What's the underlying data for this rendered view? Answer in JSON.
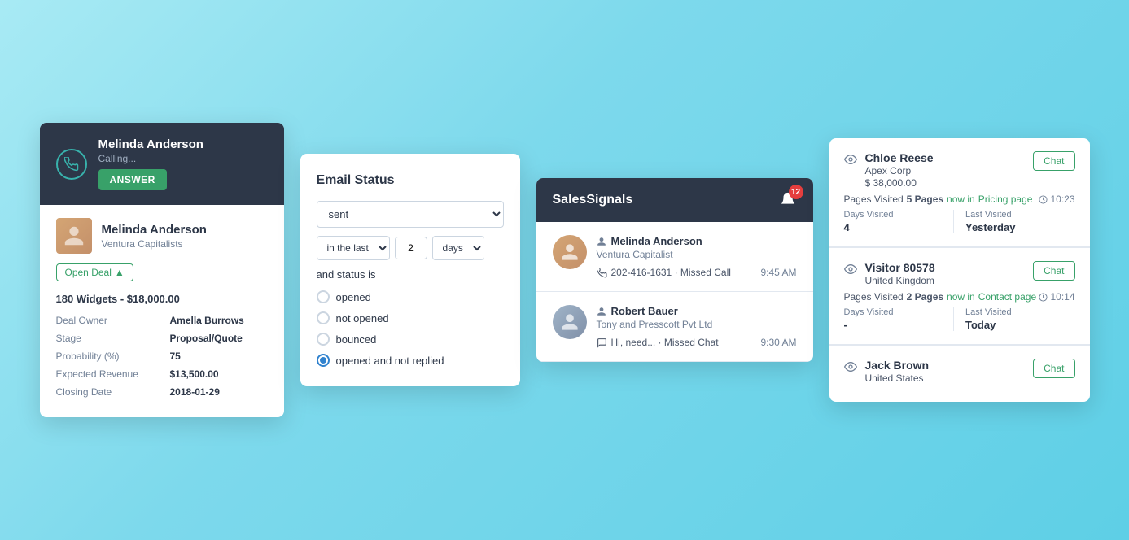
{
  "background": {
    "color_start": "#a8eaf4",
    "color_end": "#5ecfe6"
  },
  "calling_card": {
    "header": {
      "name": "Melinda Anderson",
      "status": "Calling...",
      "answer_label": "ANSWER"
    },
    "contact": {
      "name": "Melinda Anderson",
      "company": "Ventura Capitalists"
    },
    "open_deal_label": "Open Deal",
    "deal_title": "180 Widgets - $18,000.00",
    "deal_fields": [
      {
        "label": "Deal Owner",
        "value": "Amella Burrows"
      },
      {
        "label": "Stage",
        "value": "Proposal/Quote"
      },
      {
        "label": "Probability (%)",
        "value": "75"
      },
      {
        "label": "Expected Revenue",
        "value": "$13,500.00"
      },
      {
        "label": "Closing Date",
        "value": "2018-01-29"
      }
    ]
  },
  "email_panel": {
    "title": "Email Status",
    "sent_option": "sent",
    "in_the_last_label": "in the last",
    "days_value": "2",
    "days_unit": "days",
    "and_status_label": "and status is",
    "radio_options": [
      {
        "id": "opened",
        "label": "opened",
        "active": false
      },
      {
        "id": "not_opened",
        "label": "not opened",
        "active": false
      },
      {
        "id": "bounced",
        "label": "bounced",
        "active": false
      },
      {
        "id": "opened_not_replied",
        "label": "opened and not replied",
        "active": true
      }
    ]
  },
  "signals_panel": {
    "title": "SalesSignals",
    "badge_count": "12",
    "items": [
      {
        "name": "Melinda Anderson",
        "company": "Ventura Capitalist",
        "action_icon": "phone",
        "action_text": "202-416-1631 · Missed Call",
        "time": "9:45 AM"
      },
      {
        "name": "Robert Bauer",
        "company": "Tony and Presscott Pvt Ltd",
        "action_icon": "chat",
        "action_text": "Hi, need... · Missed Chat",
        "time": "9:30 AM"
      }
    ]
  },
  "tracking_panel": {
    "visitors": [
      {
        "name": "Chloe Reese",
        "company": "Apex Corp",
        "amount": "$ 38,000.00",
        "chat_label": "Chat",
        "pages_visited_text": "Pages Visited",
        "pages_visited_count": "5 Pages",
        "now_in_label": "now in",
        "current_page": "Pricing page",
        "time": "10:23",
        "days_visited_label": "Days Visited",
        "days_visited_value": "4",
        "last_visited_label": "Last Visited",
        "last_visited_value": "Yesterday",
        "icon": "eye"
      },
      {
        "name": "Visitor 80578",
        "company": "United Kingdom",
        "amount": "",
        "chat_label": "Chat",
        "pages_visited_text": "Pages Visited",
        "pages_visited_count": "2 Pages",
        "now_in_label": "now in",
        "current_page": "Contact page",
        "time": "10:14",
        "days_visited_label": "Days Visited",
        "days_visited_value": "-",
        "last_visited_label": "Last Visited",
        "last_visited_value": "Today",
        "icon": "eye"
      },
      {
        "name": "Jack Brown",
        "company": "United States",
        "amount": "",
        "chat_label": "Chat",
        "pages_visited_text": "",
        "pages_visited_count": "",
        "now_in_label": "",
        "current_page": "",
        "time": "",
        "days_visited_label": "",
        "days_visited_value": "",
        "last_visited_label": "",
        "last_visited_value": "",
        "icon": "eye"
      }
    ]
  }
}
